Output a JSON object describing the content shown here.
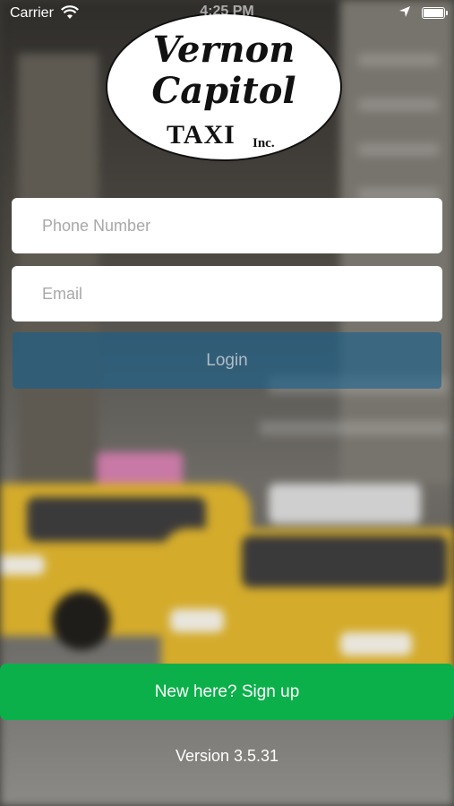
{
  "status_bar": {
    "carrier": "Carrier",
    "time": "4:25 PM",
    "wifi_icon": "wifi-icon",
    "location_icon": "location-arrow-icon",
    "battery_icon": "battery-icon"
  },
  "logo": {
    "line1": "Vernon",
    "line2": "Capitol",
    "line3": "TAXI",
    "line4": "Inc."
  },
  "form": {
    "phone_placeholder": "Phone Number",
    "phone_value": "",
    "email_placeholder": "Email",
    "email_value": "",
    "login_label": "Login"
  },
  "signup_label": "New here? Sign up",
  "version_text": "Version 3.5.31",
  "colors": {
    "login_button": "#165f8c",
    "signup_button": "#0bb04a",
    "field_background": "#ffffff"
  }
}
